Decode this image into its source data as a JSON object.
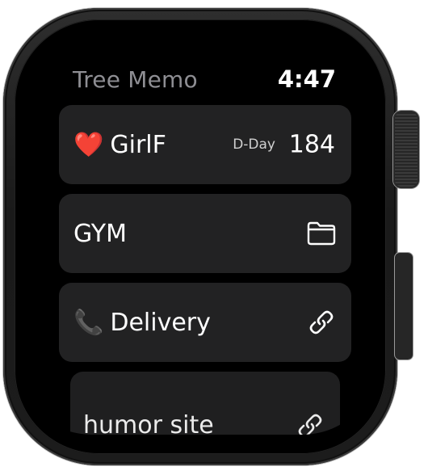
{
  "app": {
    "title": "Tree Memo",
    "time": "4:47"
  },
  "items": [
    {
      "emoji": "❤️",
      "label": "GirlF",
      "caption": "D-Day",
      "value": "184"
    },
    {
      "label": "GYM",
      "icon": "folder-icon"
    },
    {
      "emoji": "📞",
      "label": "Delivery",
      "icon": "link-icon"
    },
    {
      "label": "humor site",
      "icon": "link-icon"
    }
  ],
  "colors": {
    "background": "#000000",
    "card": "#222223",
    "title": "#8e8e93",
    "text": "#ffffff"
  }
}
